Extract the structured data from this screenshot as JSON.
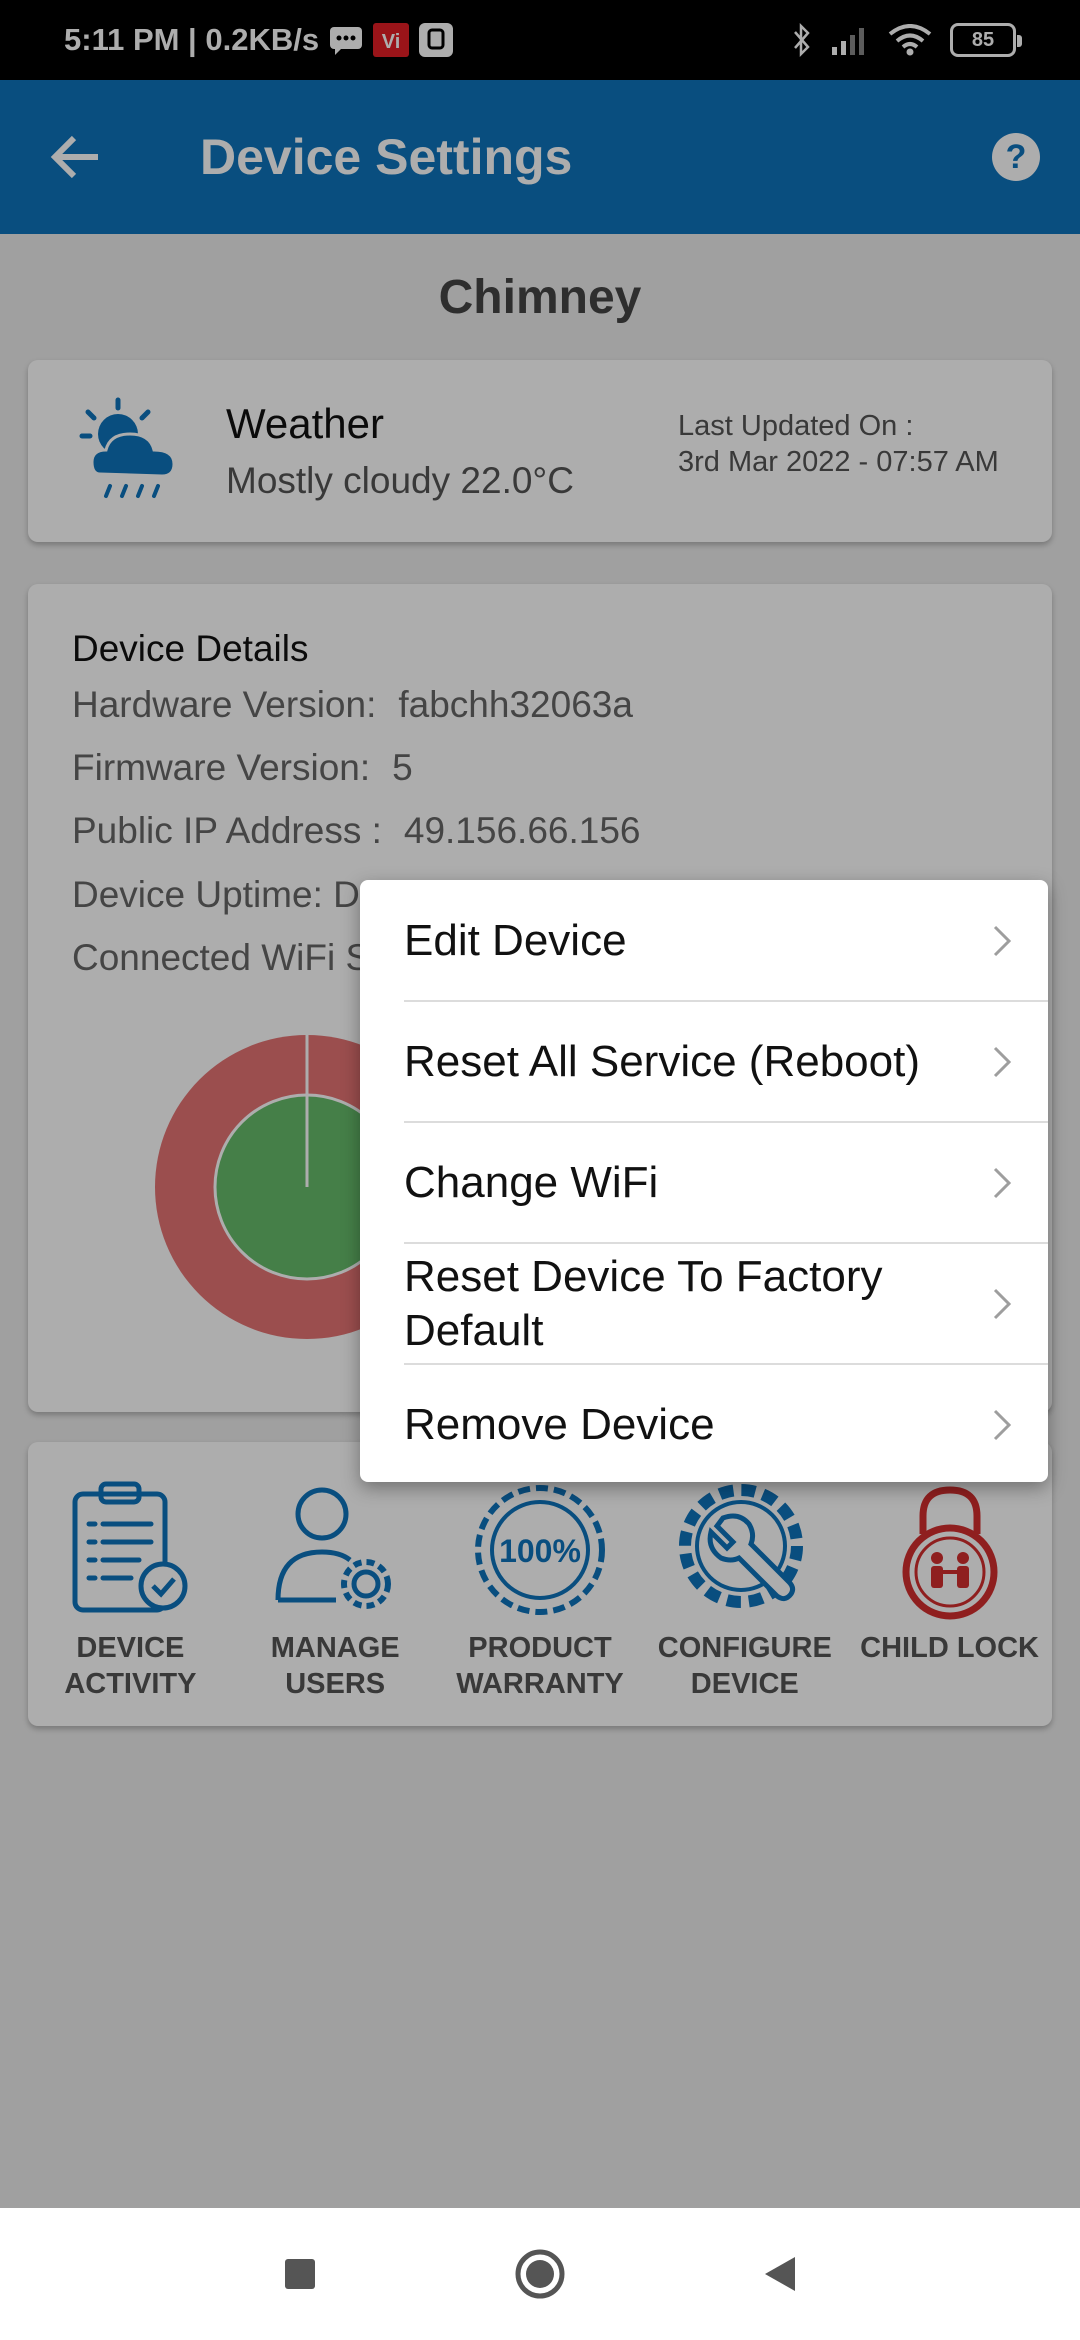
{
  "status_bar": {
    "time_speed": "5:11 PM | 0.2KB/s",
    "battery": "85"
  },
  "app_bar": {
    "title": "Device Settings",
    "help": "?"
  },
  "device_name": "Chimney",
  "weather": {
    "title": "Weather",
    "description": "Mostly cloudy 22.0°C",
    "updated_label": "Last Updated On :",
    "updated_value": "3rd Mar 2022 - 07:57 AM"
  },
  "details": {
    "title": "Device Details",
    "hardware_label": "Hardware Version:",
    "hardware_value": "fabchh32063a",
    "firmware_label": "Firmware Version:",
    "firmware_value": "5",
    "ip_label": "Public IP Address :",
    "ip_value": "49.156.66.156",
    "uptime_label": "Device Uptime:  D",
    "wifi_label": "Connected WiFi S"
  },
  "actions": [
    {
      "line1": "DEVICE",
      "line2": "ACTIVITY"
    },
    {
      "line1": "MANAGE",
      "line2": "USERS"
    },
    {
      "line1": "PRODUCT",
      "line2": "WARRANTY"
    },
    {
      "line1": "CONFIGURE",
      "line2": "DEVICE"
    },
    {
      "line1": "CHILD LOCK",
      "line2": ""
    }
  ],
  "menu": [
    {
      "label": "Edit Device"
    },
    {
      "label": "Reset All Service (Reboot)"
    },
    {
      "label": "Change WiFi"
    },
    {
      "label": "Reset Device To Factory Default"
    },
    {
      "label": "Remove Device"
    }
  ],
  "colors": {
    "primary": "#0e73bb",
    "donut_outer": "#e57373",
    "donut_inner": "#66bb6a",
    "child_lock": "#d32f2f"
  }
}
